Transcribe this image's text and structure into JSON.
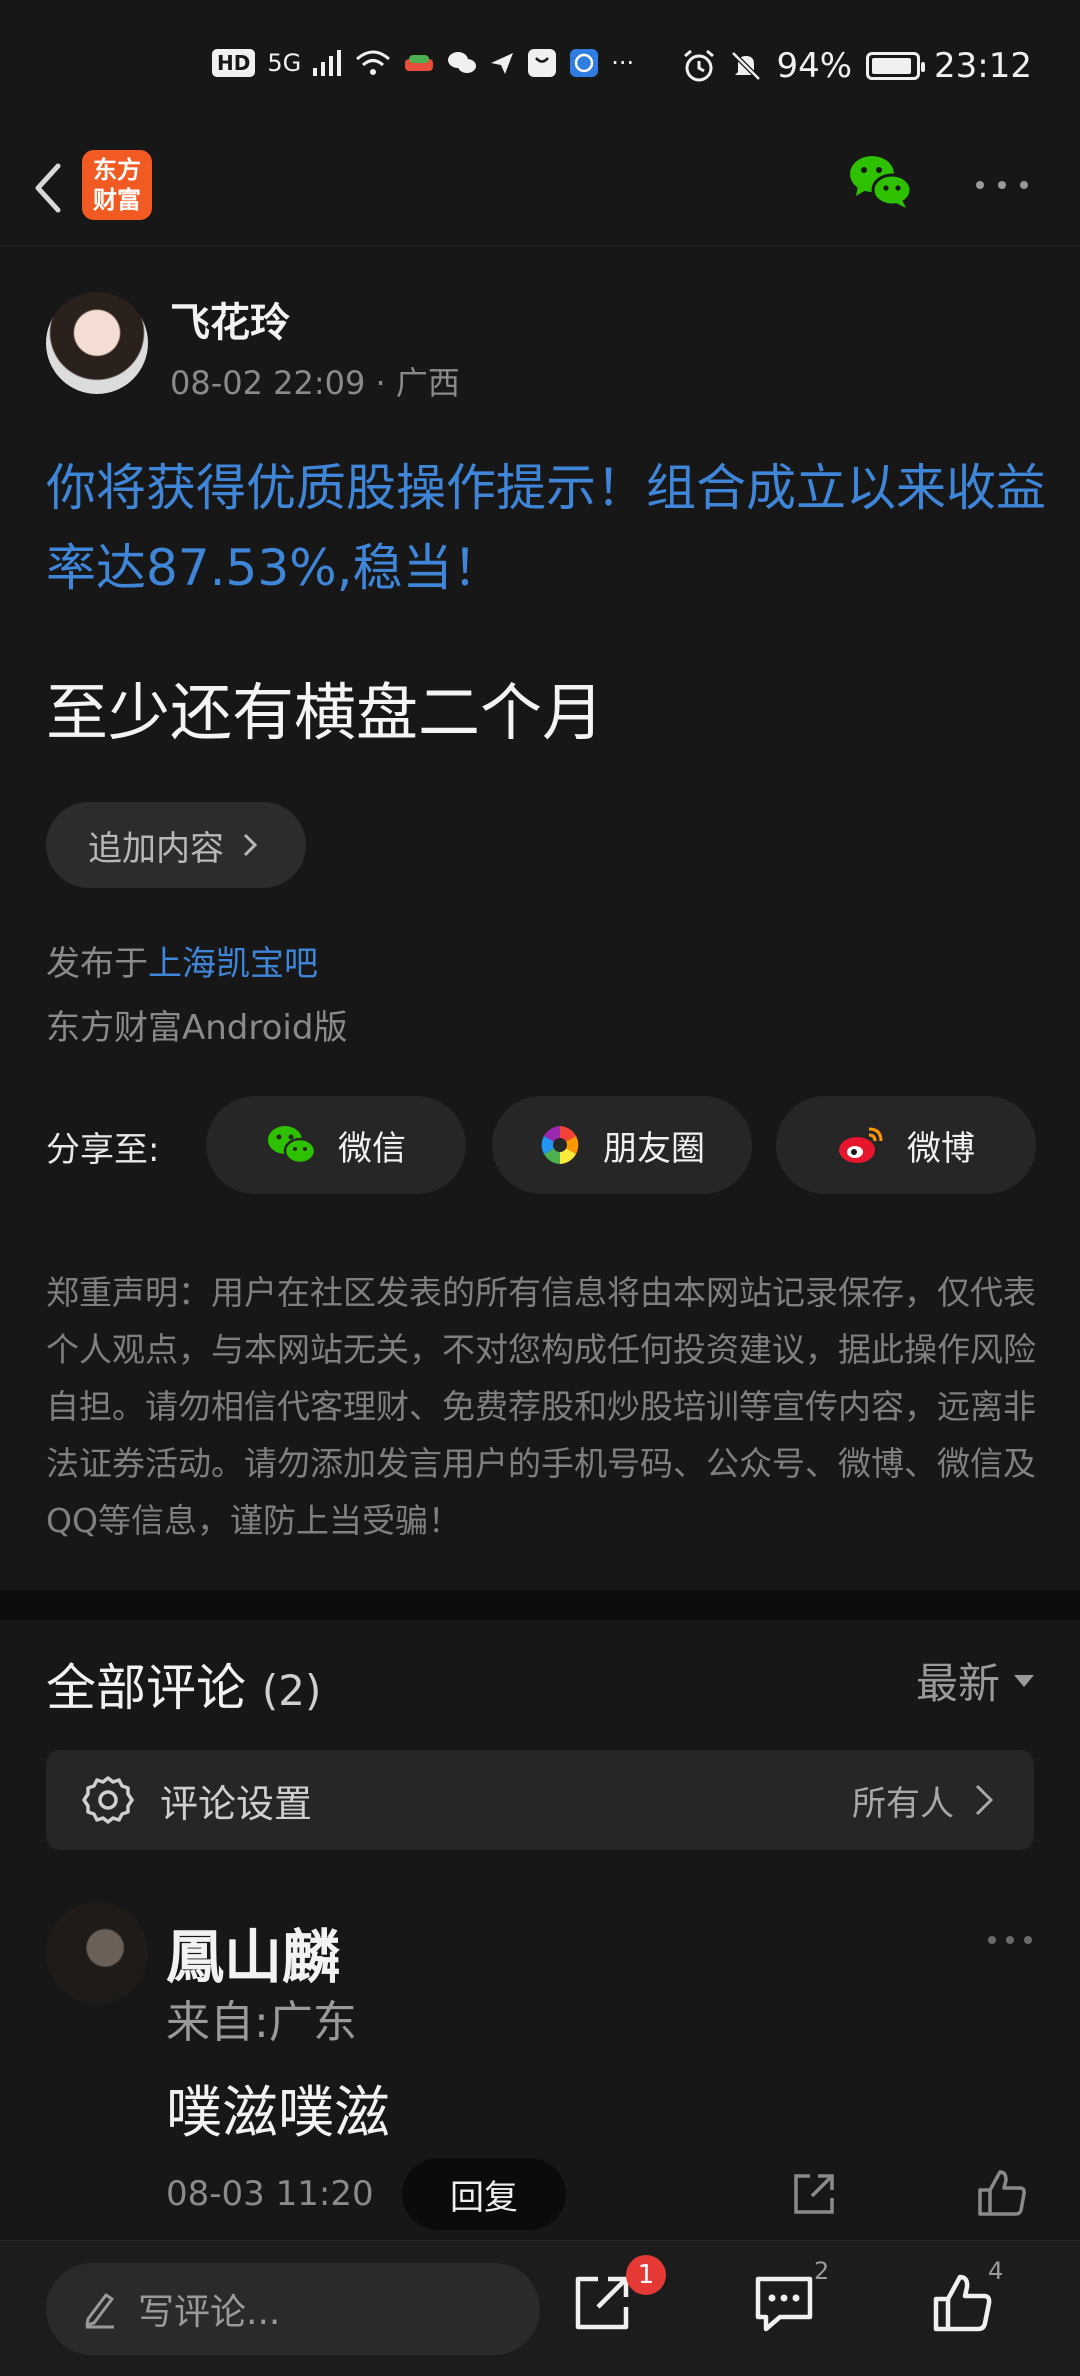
{
  "status_bar": {
    "chips": [
      "HD",
      "5G"
    ],
    "battery_text": "94%",
    "battery_level": 0.94,
    "time": "23:12",
    "overflow": "···"
  },
  "app_bar": {
    "logo_text": "东方\n财富"
  },
  "post": {
    "author": {
      "name": "飞花玲",
      "meta": "08-02 22:09 · 广西"
    },
    "promo_text": "你将获得优质股操作提示！组合成立以来收益率达87.53%,稳当！",
    "title": "至少还有横盘二个月",
    "append_button": "追加内容",
    "published_prefix": "发布于",
    "published_forum": "上海凯宝吧",
    "platform": "东方财富Android版"
  },
  "share": {
    "label": "分享至:",
    "options": [
      {
        "label": "微信",
        "icon": "wechat-icon"
      },
      {
        "label": "朋友圈",
        "icon": "moments-icon"
      },
      {
        "label": "微博",
        "icon": "weibo-icon"
      }
    ]
  },
  "disclaimer": "郑重声明：用户在社区发表的所有信息将由本网站记录保存，仅代表个人观点，与本网站无关，不对您构成任何投资建议，据此操作风险自担。请勿相信代客理财、免费荐股和炒股培训等宣传内容，远离非法证券活动。请勿添加发言用户的手机号码、公众号、微博、微信及QQ等信息，谨防上当受骗！",
  "comments": {
    "title": "全部评论",
    "count": "(2)",
    "sort": "最新",
    "settings_label": "评论设置",
    "settings_value": "所有人",
    "items": [
      {
        "name": "鳳山麟",
        "location": "来自:广东",
        "text": "噗滋噗滋",
        "time": "08-03 11:20",
        "reply": "回复"
      }
    ]
  },
  "bottom_bar": {
    "placeholder": "写评论...",
    "share_badge": "1",
    "comment_count": "2",
    "like_count": "4"
  },
  "colors": {
    "background": "#171717",
    "link_blue": "#3f86d9",
    "brand_orange": "#f15a22",
    "wechat_green": "#2dc100",
    "badge_red": "#e53935"
  }
}
